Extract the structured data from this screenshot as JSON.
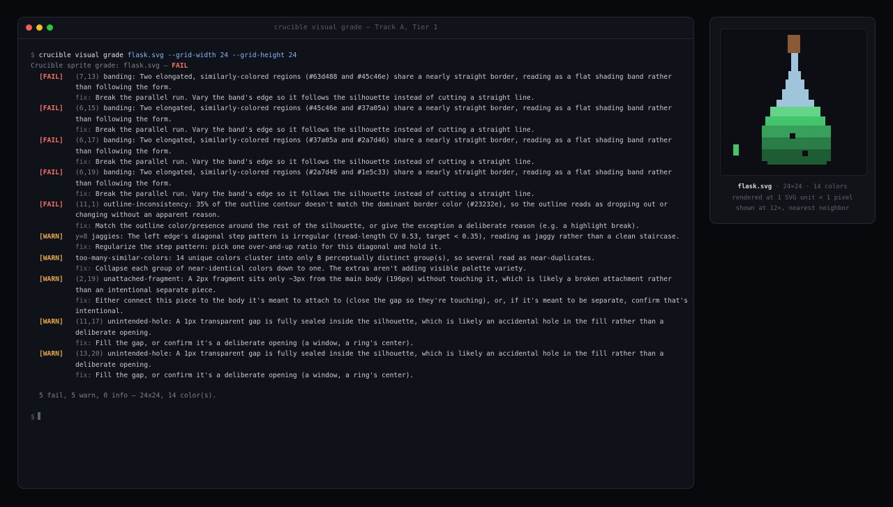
{
  "window": {
    "title": "crucible visual grade — Track A, Tier 1"
  },
  "terminal": {
    "prompt": "$",
    "command": {
      "cmd": "crucible visual grade",
      "args": "flask.svg --grid-width 24 --grid-height 24"
    },
    "header": {
      "prefix": "Crucible sprite grade: flask.svg — ",
      "result": "FAIL"
    },
    "fix_label": "fix:",
    "issues": [
      {
        "tag": "[FAIL]",
        "level": "fail",
        "loc": "(7,13)",
        "message": "banding: Two elongated, similarly-colored regions (#63d488 and #45c46e) share a nearly straight border, reading as a flat shading band rather than following the form.",
        "fix": "Break the parallel run. Vary the band's edge so it follows the silhouette instead of cutting a straight line."
      },
      {
        "tag": "[FAIL]",
        "level": "fail",
        "loc": "(6,15)",
        "message": "banding: Two elongated, similarly-colored regions (#45c46e and #37a05a) share a nearly straight border, reading as a flat shading band rather than following the form.",
        "fix": "Break the parallel run. Vary the band's edge so it follows the silhouette instead of cutting a straight line."
      },
      {
        "tag": "[FAIL]",
        "level": "fail",
        "loc": "(6,17)",
        "message": "banding: Two elongated, similarly-colored regions (#37a05a and #2a7d46) share a nearly straight border, reading as a flat shading band rather than following the form.",
        "fix": "Break the parallel run. Vary the band's edge so it follows the silhouette instead of cutting a straight line."
      },
      {
        "tag": "[FAIL]",
        "level": "fail",
        "loc": "(6,19)",
        "message": "banding: Two elongated, similarly-colored regions (#2a7d46 and #1e5c33) share a nearly straight border, reading as a flat shading band rather than following the form.",
        "fix": "Break the parallel run. Vary the band's edge so it follows the silhouette instead of cutting a straight line."
      },
      {
        "tag": "[FAIL]",
        "level": "fail",
        "loc": "(11,1)",
        "message": "outline-inconsistency: 35% of the outline contour doesn't match the dominant border color (#23232e), so the outline reads as dropping out or changing without an apparent reason.",
        "fix": "Match the outline color/presence around the rest of the silhouette, or give the exception a deliberate reason (e.g. a highlight break)."
      },
      {
        "tag": "[WARN]",
        "level": "warn",
        "loc": "y=8",
        "message": "jaggies: The left edge's diagonal step pattern is irregular (tread-length CV 0.53, target < 0.35), reading as jaggy rather than a clean staircase.",
        "fix": "Regularize the step pattern: pick one over-and-up ratio for this diagonal and hold it."
      },
      {
        "tag": "[WARN]",
        "level": "warn",
        "loc": "",
        "message": "too-many-similar-colors: 14 unique colors cluster into only 8 perceptually distinct group(s), so several read as near-duplicates.",
        "fix": "Collapse each group of near-identical colors down to one. The extras aren't adding visible palette variety."
      },
      {
        "tag": "[WARN]",
        "level": "warn",
        "loc": "(2,19)",
        "message": "unattached-fragment: A 2px fragment sits only ~3px from the main body (196px) without touching it, which is likely a broken attachment rather than an intentional separate piece.",
        "fix": "Either connect this piece to the body it's meant to attach to (close the gap so they're touching), or, if it's meant to be separate, confirm that's intentional."
      },
      {
        "tag": "[WARN]",
        "level": "warn",
        "loc": "(11,17)",
        "message": "unintended-hole: A 1px transparent gap is fully sealed inside the silhouette, which is likely an accidental hole in the fill rather than a deliberate opening.",
        "fix": "Fill the gap, or confirm it's a deliberate opening (a window, a ring's center)."
      },
      {
        "tag": "[WARN]",
        "level": "warn",
        "loc": "(13,20)",
        "message": "unintended-hole: A 1px transparent gap is fully sealed inside the silhouette, which is likely an accidental hole in the fill rather than a deliberate opening.",
        "fix": "Fill the gap, or confirm it's a deliberate opening (a window, a ring's center)."
      }
    ],
    "summary": "5 fail, 5 warn, 0 info — 24x24, 14 color(s)."
  },
  "colors": {
    "fail": "#f47067",
    "warn": "#e6a94a",
    "arg": "#8ab4f8",
    "cork": "#8b5a34",
    "glass": "#9fc4dc",
    "liquid_top": "#63d488",
    "liquid_2": "#45c46e",
    "liquid_3": "#37a05a",
    "liquid_4": "#2a7d46",
    "liquid_5": "#1e5c33"
  },
  "preview": {
    "filename": "flask.svg",
    "meta": " · 24×24 · 14 colors",
    "line2": "rendered at 1 SVG unit = 1 pixel",
    "line3": "shown at 12×, nearest neighbor"
  }
}
